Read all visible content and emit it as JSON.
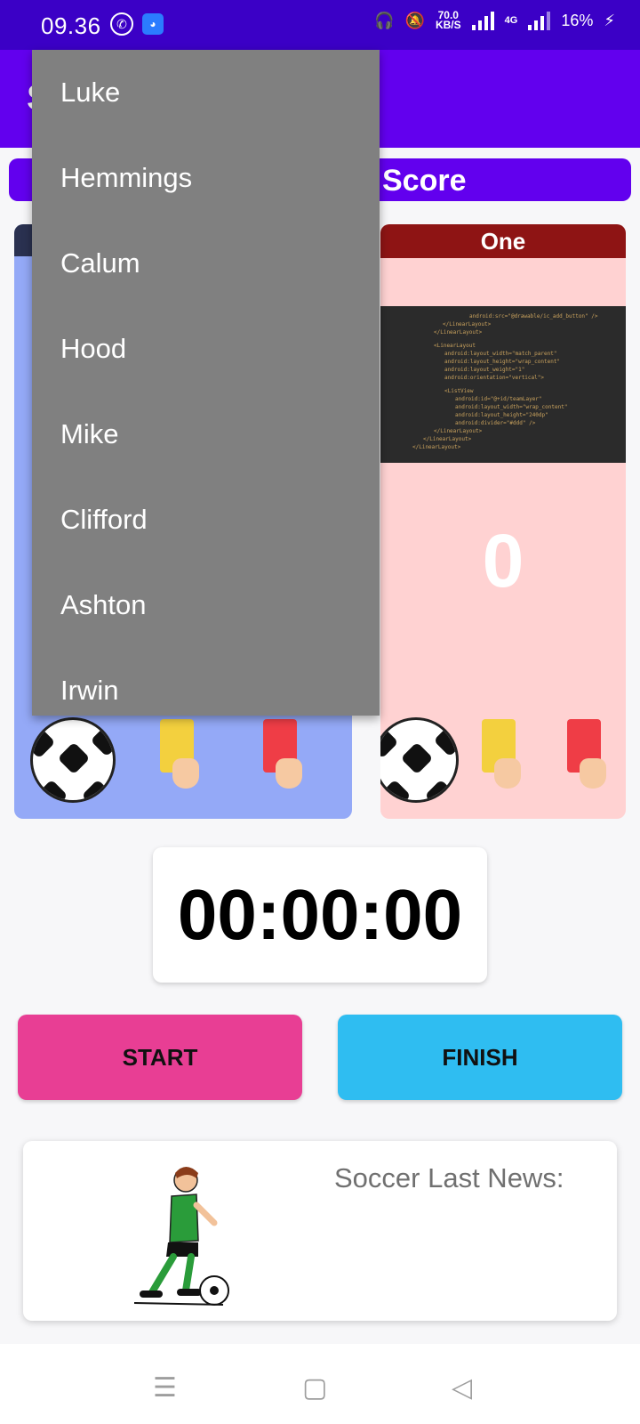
{
  "status_bar": {
    "time": "09.36",
    "net_speed_value": "70.0",
    "net_speed_unit": "KB/S",
    "network_type": "4G",
    "battery": "16%"
  },
  "app_bar": {
    "title": "S"
  },
  "score_banner": {
    "label": "Score"
  },
  "team_right": {
    "name": "One",
    "score": "0"
  },
  "code_lines": [
    "android:src=\"@drawable/ic_add_button\" />",
    "</LinearLayout>",
    "</LinearLayout>",
    "<LinearLayout",
    "android:layout_width=\"match_parent\"",
    "android:layout_height=\"wrap_content\"",
    "android:layout_weight=\"1\"",
    "android:orientation=\"vertical\">",
    "<ListView",
    "android:id=\"@+id/teamLayer\"",
    "android:layout_width=\"wrap_content\"",
    "android:layout_height=\"240dp\"",
    "android:divider=\"#ddd\" />",
    "</LinearLayout>",
    "</LinearLayout>",
    "</LinearLayout>"
  ],
  "dropdown": {
    "items": [
      "Luke",
      "Hemmings",
      "Calum",
      "Hood",
      "Mike",
      "Clifford",
      "Ashton",
      "Irwin"
    ]
  },
  "timer": {
    "value": "00:00:00"
  },
  "buttons": {
    "start": "START",
    "finish": "FINISH"
  },
  "news": {
    "title": "Soccer Last News:"
  },
  "colors": {
    "status_bar": "#3b00c6",
    "app_bar": "#6200ee",
    "team_left_bg": "#94a9f7",
    "team_right_bg": "#ffd2d2",
    "team_right_header": "#8e1414",
    "start_button": "#e83e94",
    "finish_button": "#2fbdf1",
    "dropdown_bg": "#808080"
  },
  "icons": {
    "whatsapp": "whatsapp-icon",
    "app": "android-app-icon",
    "headphones": "headphones-icon",
    "mute": "bell-off-icon",
    "signal": "signal-icon",
    "battery": "battery-charging-icon",
    "ball": "soccer-ball-icon",
    "yellow_card": "yellow-card-icon",
    "red_card": "red-card-icon",
    "nav_menu": "menu-icon",
    "nav_home": "home-square-icon",
    "nav_back": "back-triangle-icon"
  }
}
